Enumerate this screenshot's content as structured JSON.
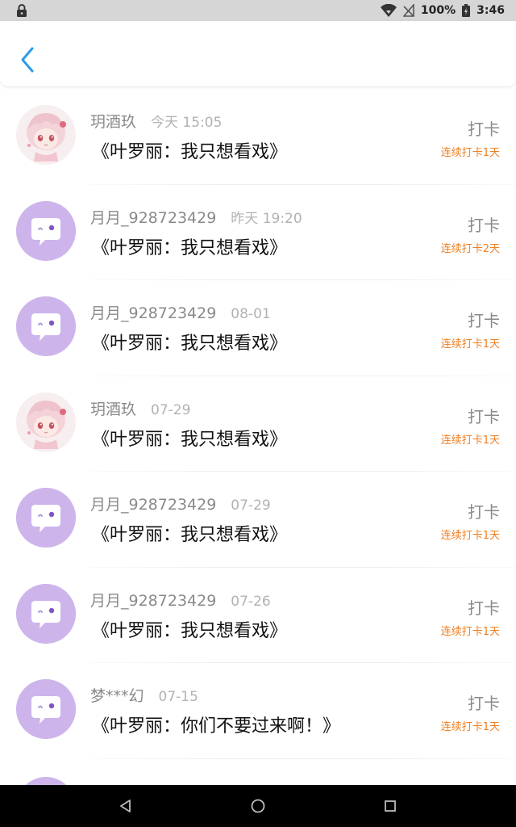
{
  "status_bar": {
    "battery": "100%",
    "time": "3:46"
  },
  "colors": {
    "accent_back": "#2d9ce9",
    "streak": "#ef7f22",
    "default_avatar_bg": "#cdb5ec"
  },
  "icons": {
    "status_left": "lock-icon",
    "wifi": "wifi-icon",
    "signal": "no-signal-icon",
    "battery": "battery-icon",
    "back": "back-chevron-icon"
  },
  "entries": [
    {
      "avatar": "anime",
      "name": "玥酒玖",
      "time": "今天 15:05",
      "title": "《叶罗丽：我只想看戏》",
      "checkin": "打卡",
      "streak": "连续打卡1天"
    },
    {
      "avatar": "default",
      "name": "月月_928723429",
      "time": "昨天 19:20",
      "title": "《叶罗丽：我只想看戏》",
      "checkin": "打卡",
      "streak": "连续打卡2天"
    },
    {
      "avatar": "default",
      "name": "月月_928723429",
      "time": "08-01",
      "title": "《叶罗丽：我只想看戏》",
      "checkin": "打卡",
      "streak": "连续打卡1天"
    },
    {
      "avatar": "anime",
      "name": "玥酒玖",
      "time": "07-29",
      "title": "《叶罗丽：我只想看戏》",
      "checkin": "打卡",
      "streak": "连续打卡1天"
    },
    {
      "avatar": "default",
      "name": "月月_928723429",
      "time": "07-29",
      "title": "《叶罗丽：我只想看戏》",
      "checkin": "打卡",
      "streak": "连续打卡1天"
    },
    {
      "avatar": "default",
      "name": "月月_928723429",
      "time": "07-26",
      "title": "《叶罗丽：我只想看戏》",
      "checkin": "打卡",
      "streak": "连续打卡1天"
    },
    {
      "avatar": "default",
      "name": "梦***幻",
      "time": "07-15",
      "title": "《叶罗丽：你们不要过来啊！》",
      "checkin": "打卡",
      "streak": "连续打卡1天"
    }
  ],
  "nav_bar": {
    "back": "nav-back-icon",
    "home": "nav-home-icon",
    "recents": "nav-recents-icon"
  }
}
